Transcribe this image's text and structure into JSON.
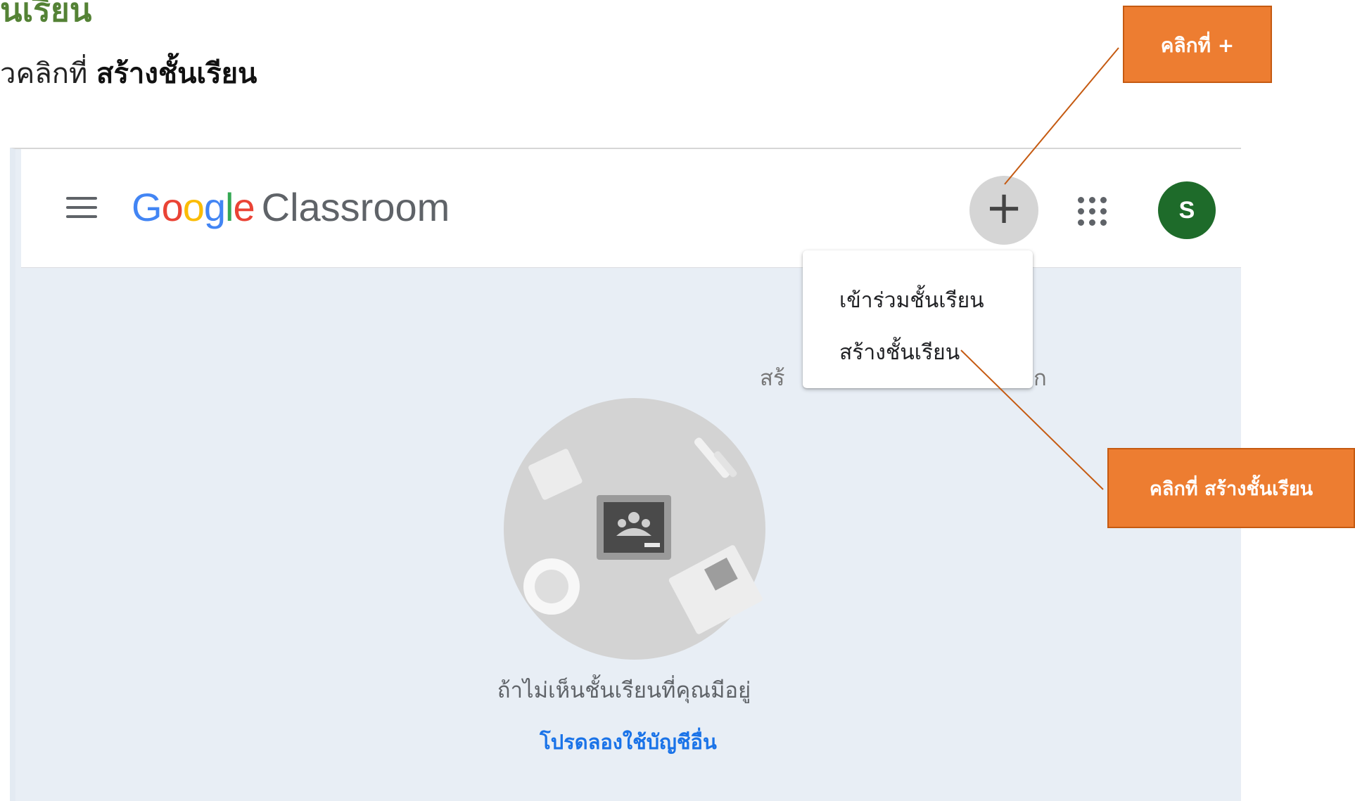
{
  "heading": "นเรียน",
  "instruction": {
    "prefix": "วคลิกที่ ",
    "bold": "สร้างชั้นเรียน"
  },
  "classroom": {
    "logo": {
      "google": [
        "G",
        "o",
        "o",
        "g",
        "l",
        "e"
      ],
      "product": "Classroom"
    },
    "plus_label": "+",
    "avatar_letter": "S",
    "menu": {
      "join": "เข้าร่วมชั้นเรียน",
      "create": "สร้างชั้นเรียน"
    },
    "behind_text_left": "สร้",
    "behind_text_right": "ก",
    "empty_message": "ถ้าไม่เห็นชั้นเรียนที่คุณมีอยู่",
    "try_other_account": "โปรดลองใช้บัญชีอื่น"
  },
  "callouts": {
    "plus": "คลิกที่ +",
    "create": "คลิกที่ สร้างชั้นเรียน"
  },
  "colors": {
    "heading": "#548235",
    "callout": "#ed7d31",
    "avatar": "#1e6b2a",
    "link": "#1a73e8",
    "google_blue": "#4285f4",
    "google_red": "#ea4335",
    "google_yellow": "#fbbc05",
    "google_green": "#34a853"
  }
}
